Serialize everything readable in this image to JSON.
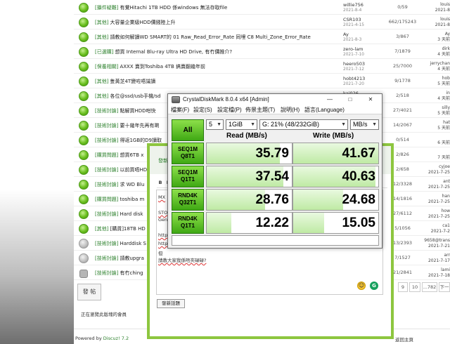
{
  "forum": {
    "threads": [
      {
        "cat": "[攝件疑難]",
        "title": "有覺Hitachi 1TB HDD 係windows 無法存取file",
        "author": "willie756",
        "date": "2021-8-4",
        "stats": "0/59",
        "last": "louis",
        "last_date": "2021-8",
        "icon": "green"
      },
      {
        "cat": "[其他]",
        "title": "大容量企業級HDD價錢陸上升",
        "author": "CSR103",
        "date": "2021-4-15",
        "stats": "662/175243",
        "last": "louis",
        "last_date": "2021-8",
        "icon": "green"
      },
      {
        "cat": "[其他]",
        "title": "請教如何解讀WD SMART的 01 Raw_Read_Error_Rate 同埋 C8 Multi_Zone_Error_Rate",
        "author": "Ay",
        "date": "2021-8-3",
        "stats": "3/867",
        "last": "Ay",
        "last_date": "3 天前",
        "icon": "green"
      },
      {
        "cat": "[已選購]",
        "title": "想買 Internal Blu-ray Ultra HD Drive, 有冇價推介?",
        "author": "zero-lam",
        "date": "2021-7-10",
        "stats": "7/1879",
        "last": "dirk",
        "last_date": "4 天前",
        "icon": "green"
      },
      {
        "cat": "[保養相關]",
        "title": "AXXX 賣到Toshiba 4TB 搞賣翻幾年前",
        "author": "heero503",
        "date": "2021-7-12",
        "stats": "25/7000",
        "last": "jerrychan",
        "last_date": "4 天前",
        "icon": "green"
      },
      {
        "cat": "[其他]",
        "title": "隻黃芝4T變咗唔識讀",
        "author": "hobt4213",
        "date": "2021-7-20",
        "stats": "9/1778",
        "last": "hob",
        "last_date": "5 天前",
        "icon": "green"
      },
      {
        "cat": "[其他]",
        "title": "各位@ssd/usb手機/sd",
        "author": "kai026",
        "date": "2021-7-14",
        "stats": "2/518",
        "last": "in",
        "last_date": "4 天前",
        "icon": "green"
      },
      {
        "cat": "[技術討論]",
        "title": "點解買HDD咁快",
        "author": "",
        "date": "",
        "stats": "27/4021",
        "last": "silly",
        "last_date": "5 天前",
        "icon": "green"
      },
      {
        "cat": "[技術討論]",
        "title": "要十幾年先再有啲",
        "author": "",
        "date": "",
        "stats": "14/2067",
        "last": "hat",
        "last_date": "5 天前",
        "icon": "green"
      },
      {
        "cat": "[技術討論]",
        "title": "得返1GB的D9讀取",
        "author": "",
        "date": "",
        "stats": "0/514",
        "last": "",
        "last_date": "6 天前",
        "icon": "green"
      },
      {
        "cat": "[購買問題]",
        "title": "想買6TB x",
        "author": "",
        "date": "",
        "stats": "2/826",
        "last": "",
        "last_date": "7 天前",
        "icon": "green"
      },
      {
        "cat": "[技術討論]",
        "title": "以前買唔HD",
        "author": "",
        "date": "",
        "stats": "2/658",
        "last": "cyjoe",
        "last_date": "2021-7-25",
        "icon": "green"
      },
      {
        "cat": "[技術討論]",
        "title": "求 WD Blu",
        "author": "",
        "date": "",
        "stats": "12/3328",
        "last": "ant",
        "last_date": "2021-7-25",
        "icon": "green"
      },
      {
        "cat": "[購買問題]",
        "title": "toshiba m",
        "author": "",
        "date": "",
        "stats": "14/1816",
        "last": "han",
        "last_date": "2021-7-25",
        "icon": "green"
      },
      {
        "cat": "[技術討論]",
        "title": "Hard disk",
        "author": "",
        "date": "",
        "stats": "27/6112",
        "last": "how",
        "last_date": "2021-7-25",
        "icon": "green"
      },
      {
        "cat": "[其他]",
        "title": "[購貨]18TB HD",
        "author": "",
        "date": "",
        "stats": "5/1056",
        "last": "ca1",
        "last_date": "2021-7-2",
        "icon": "green"
      },
      {
        "cat": "[技術討論]",
        "title": "Harddisk S",
        "author": "",
        "date": "",
        "stats": "13/2393",
        "last": "9658@trans",
        "last_date": "2021-7-21",
        "icon": "grey"
      },
      {
        "cat": "[技術討論]",
        "title": "請教upgra",
        "author": "",
        "date": "",
        "stats": "7/1527",
        "last": "arr",
        "last_date": "2021-7-17",
        "icon": "grey"
      },
      {
        "cat": "[技術討論]",
        "title": "有冇ching",
        "author": "",
        "date": "",
        "stats": "21/2841",
        "last": "lami",
        "last_date": "2021-7-18",
        "icon": "lock"
      }
    ],
    "post_button": "發 帖",
    "viewing": "正在瀏覽此版塊的會員",
    "powered": "Powered by",
    "powered_brand": "Discuz! 7.2",
    "home_link": "返回主頁",
    "pager": [
      "9",
      "10",
      "...782",
      "下一"
    ]
  },
  "reply": {
    "title": "發新",
    "toolbar": [
      "B",
      "I",
      "U"
    ],
    "lines": [
      "MX",
      "STO",
      "Gen",
      "http",
      "http",
      "但",
      "請教大家我係唔夾碌碌?"
    ],
    "submit": "發新話題",
    "emoji_icon": "☺",
    "grammar_icon": "G"
  },
  "cdm": {
    "title": "CrystalDiskMark 8.0.4 x64 [Admin]",
    "menu": [
      "檔案(F)",
      "設定(S)",
      "設定檔(P)",
      "佈景主題(T)",
      "說明(H)",
      "語言(Language)"
    ],
    "all_label": "All",
    "count": "5",
    "size": "1GiB",
    "drive": "G: 21% (48/232GiB)",
    "unit": "MB/s",
    "read_header": "Read (MB/s)",
    "write_header": "Write (MB/s)",
    "rows": [
      {
        "l1": "SEQ1M",
        "l2": "Q8T1",
        "read": "35.79",
        "write": "41.67",
        "read_frac": 0.86,
        "write_frac": 1.0
      },
      {
        "l1": "SEQ1M",
        "l2": "Q1T1",
        "read": "37.54",
        "write": "40.63",
        "read_frac": 0.9,
        "write_frac": 0.97
      },
      {
        "l1": "RND4K",
        "l2": "Q32T1",
        "read": "28.76",
        "write": "24.68",
        "read_frac": 0.69,
        "write_frac": 0.59
      },
      {
        "l1": "RND4K",
        "l2": "Q1T1",
        "read": "12.22",
        "write": "15.05",
        "read_frac": 0.29,
        "write_frac": 0.36
      }
    ],
    "controls": [
      "—",
      "□",
      "✕"
    ]
  }
}
